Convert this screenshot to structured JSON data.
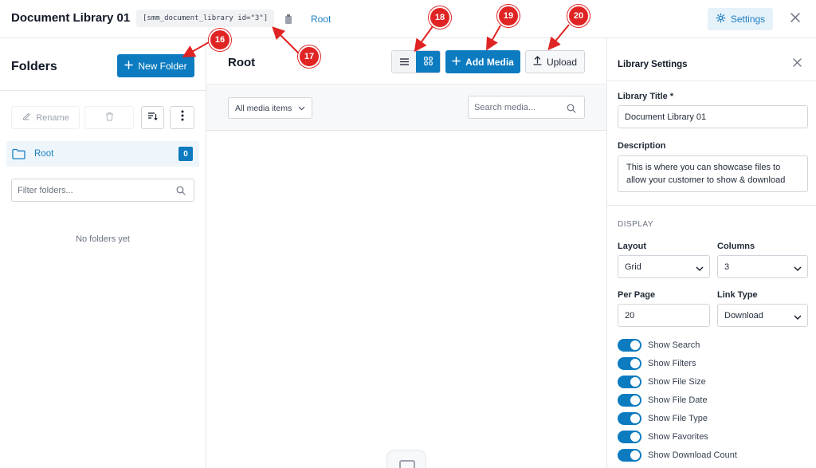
{
  "header": {
    "title": "Document Library 01",
    "shortcode": "[smm_document_library id=\"3\"]",
    "breadcrumb_root": "Root",
    "settings_label": "Settings"
  },
  "folders_panel": {
    "title": "Folders",
    "new_folder_label": "New Folder",
    "rename_label": "Rename",
    "root_label": "Root",
    "root_count": "0",
    "filter_placeholder": "Filter folders...",
    "empty_text": "No folders yet"
  },
  "main": {
    "title": "Root",
    "add_media_label": "Add Media",
    "upload_label": "Upload",
    "media_filter_value": "All media items",
    "search_placeholder": "Search media..."
  },
  "settings_panel": {
    "title": "Library Settings",
    "library_title_label": "Library Title *",
    "library_title_value": "Document Library 01",
    "description_label": "Description",
    "description_value": "This is where you can showcase files to allow your customer to show & download",
    "display_section": "DISPLAY",
    "layout_label": "Layout",
    "layout_value": "Grid",
    "columns_label": "Columns",
    "columns_value": "3",
    "per_page_label": "Per Page",
    "per_page_value": "20",
    "link_type_label": "Link Type",
    "link_type_value": "Download",
    "toggles": [
      {
        "label": "Show Search",
        "on": true
      },
      {
        "label": "Show Filters",
        "on": true
      },
      {
        "label": "Show File Size",
        "on": true
      },
      {
        "label": "Show File Date",
        "on": true
      },
      {
        "label": "Show File Type",
        "on": true
      },
      {
        "label": "Show Favorites",
        "on": true
      },
      {
        "label": "Show Download Count",
        "on": true
      }
    ]
  },
  "annotations": [
    "16",
    "17",
    "18",
    "19",
    "20"
  ],
  "colors": {
    "accent": "#0c7bc0",
    "link": "#1d7fc1",
    "annotation": "#e02424"
  }
}
